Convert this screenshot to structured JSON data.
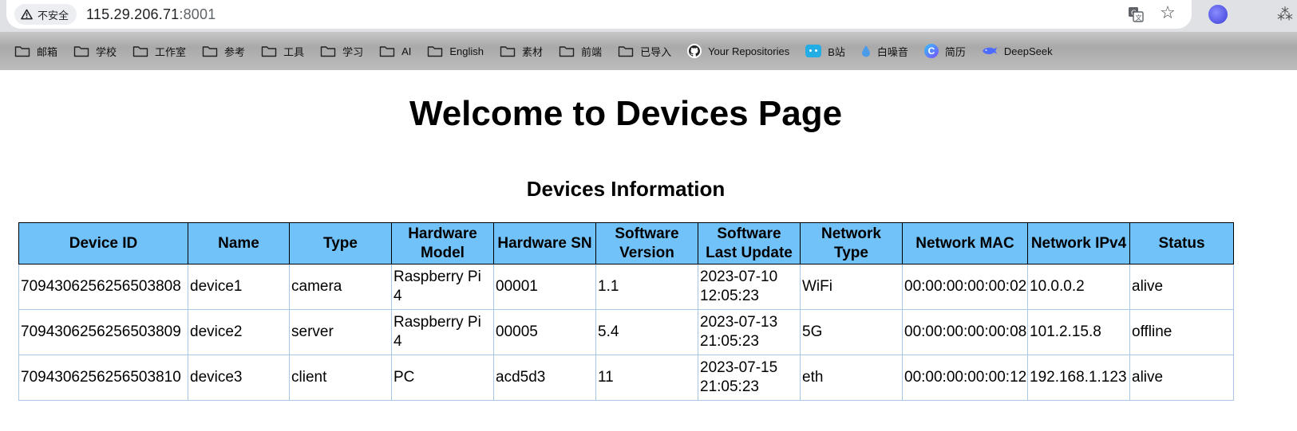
{
  "browser": {
    "security_label": "不安全",
    "url_host": "115.29.206.71",
    "url_port": ":8001"
  },
  "bookmarks": [
    {
      "label": "邮箱",
      "icon": "folder-icon"
    },
    {
      "label": "学校",
      "icon": "folder-icon"
    },
    {
      "label": "工作室",
      "icon": "folder-icon"
    },
    {
      "label": "参考",
      "icon": "folder-icon"
    },
    {
      "label": "工具",
      "icon": "folder-icon"
    },
    {
      "label": "学习",
      "icon": "folder-icon"
    },
    {
      "label": "AI",
      "icon": "folder-icon"
    },
    {
      "label": "English",
      "icon": "folder-icon"
    },
    {
      "label": "素材",
      "icon": "folder-icon"
    },
    {
      "label": "前端",
      "icon": "folder-icon"
    },
    {
      "label": "已导入",
      "icon": "folder-icon"
    },
    {
      "label": "Your Repositories",
      "icon": "github-icon"
    },
    {
      "label": "B站",
      "icon": "bilibili-icon"
    },
    {
      "label": "白噪音",
      "icon": "water-drop-icon"
    },
    {
      "label": "简历",
      "icon": "resume-app-icon"
    },
    {
      "label": "DeepSeek",
      "icon": "deepseek-whale-icon"
    }
  ],
  "page": {
    "title": "Welcome to Devices Page",
    "section_title": "Devices Information"
  },
  "table": {
    "headers": [
      "Device ID",
      "Name",
      "Type",
      "Hardware Model",
      "Hardware SN",
      "Software Version",
      "Software Last Update",
      "Network Type",
      "Network MAC",
      "Network IPv4",
      "Status"
    ],
    "rows": [
      [
        "7094306256256503808",
        "device1",
        "camera",
        "Raspberry Pi 4",
        "00001",
        "1.1",
        "2023-07-10 12:05:23",
        "WiFi",
        "00:00:00:00:00:02",
        "10.0.0.2",
        "alive"
      ],
      [
        "7094306256256503809",
        "device2",
        "server",
        "Raspberry Pi 4",
        "00005",
        "5.4",
        "2023-07-13 21:05:23",
        "5G",
        "00:00:00:00:00:08",
        "101.2.15.8",
        "offline"
      ],
      [
        "7094306256256503810",
        "device3",
        "client",
        "PC",
        "acd5d3",
        "11",
        "2023-07-15 21:05:23",
        "eth",
        "00:00:00:00:00:12",
        "192.168.1.123",
        "alive"
      ]
    ]
  },
  "colors": {
    "header_bg": "#72c2fa",
    "cell_border": "#a9c8e8",
    "bookmark_bar": "#b3b3b3"
  }
}
